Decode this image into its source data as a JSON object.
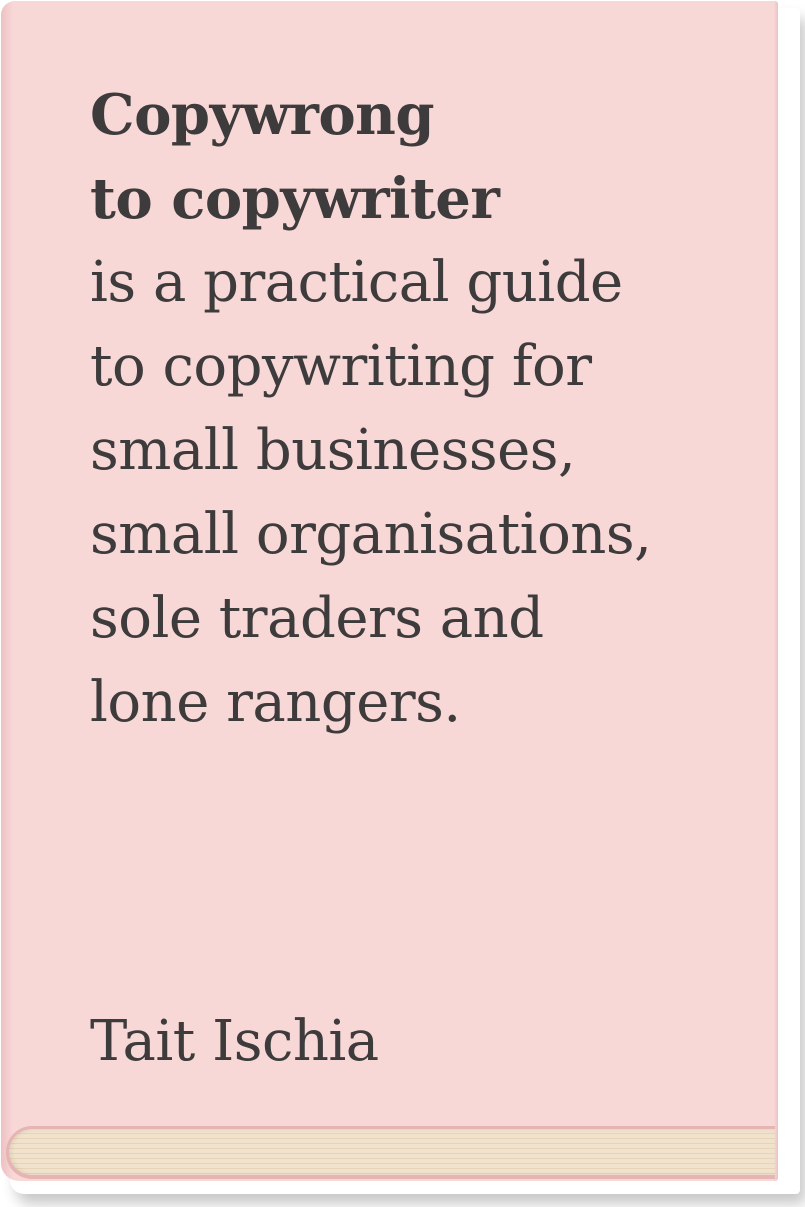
{
  "book": {
    "title_lines": [
      "Copywrong",
      "to copywriter"
    ],
    "description_lines": [
      "is a practical guide",
      "to copywriting for",
      "small businesses,",
      "small organisations,",
      "sole traders and",
      "lone rangers."
    ],
    "author": "Tait Ischia",
    "colors": {
      "cover": "#f8d7d7",
      "text": "#3d3b3b",
      "page_edge": "#f1e2cd",
      "page_border": "#e7b4b4"
    }
  }
}
